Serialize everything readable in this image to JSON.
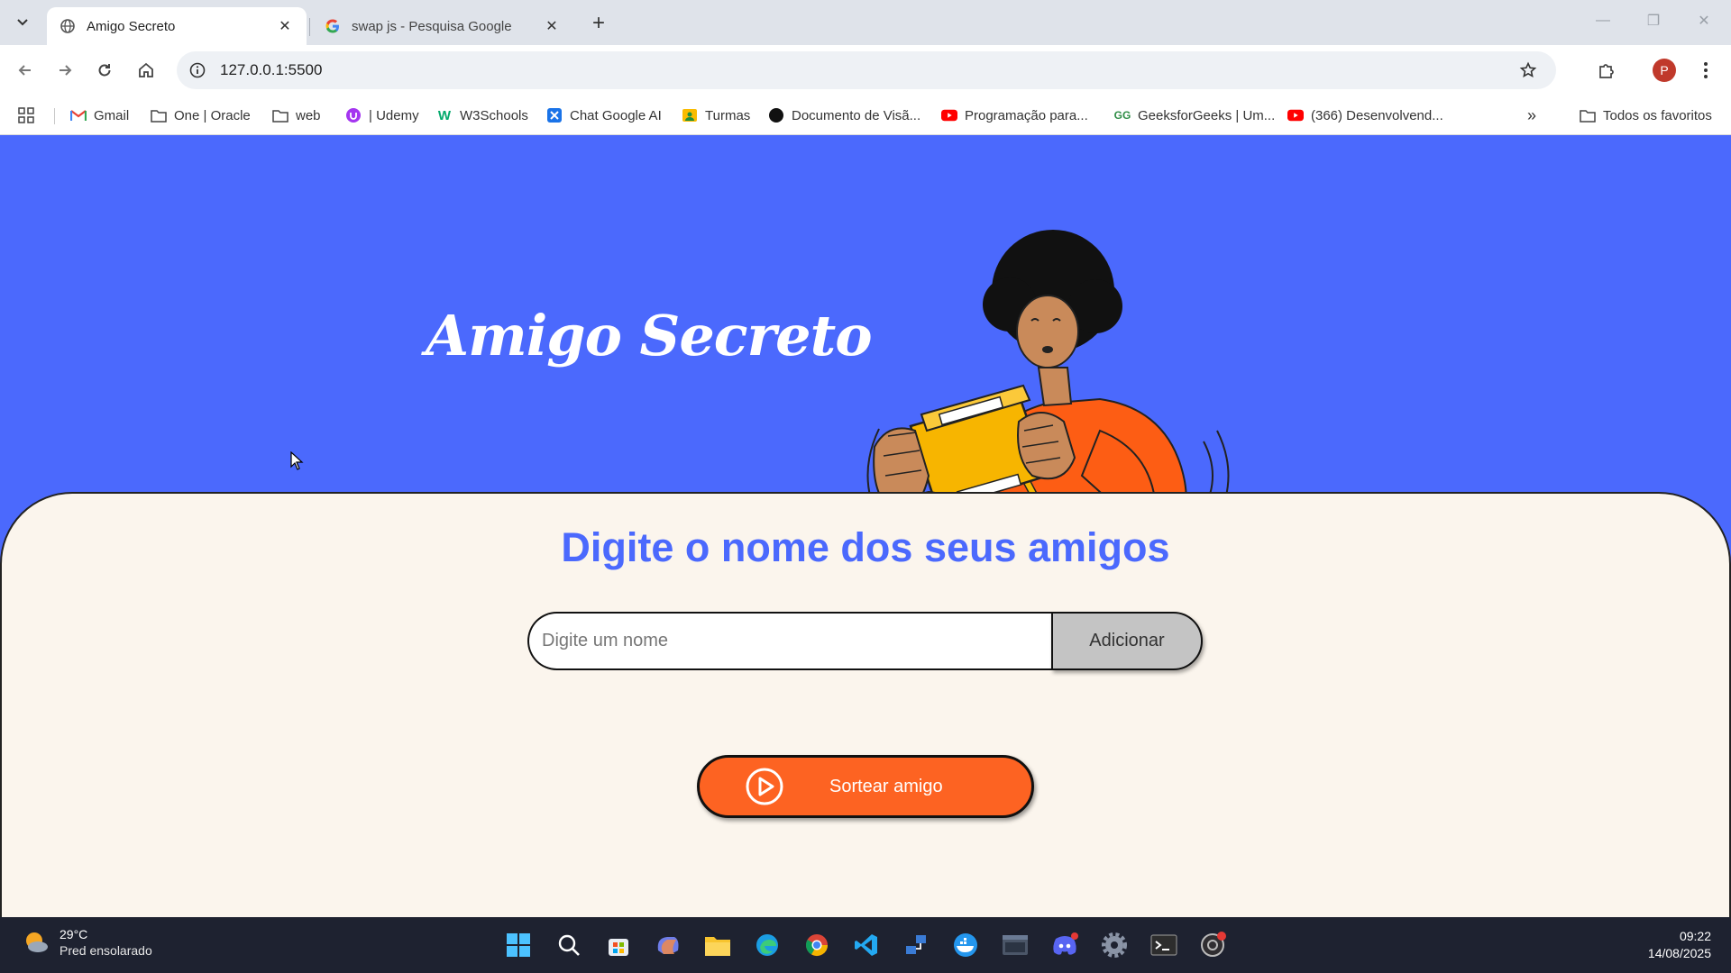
{
  "browser": {
    "tabs": [
      {
        "title": "Amigo Secreto",
        "active": true,
        "favicon": "globe-icon"
      },
      {
        "title": "swap js - Pesquisa Google",
        "active": false,
        "favicon": "google-g-icon"
      }
    ],
    "url": "127.0.0.1:5500",
    "profile_initial": "P",
    "bookmarks": [
      {
        "label": "Gmail",
        "icon": "gmail-icon"
      },
      {
        "label": "One | Oracle",
        "icon": "folder-icon"
      },
      {
        "label": "web",
        "icon": "folder-icon"
      },
      {
        "label": "| Udemy",
        "icon": "udemy-icon"
      },
      {
        "label": "W3Schools",
        "icon": "w3schools-icon"
      },
      {
        "label": "Chat Google AI",
        "icon": "chat-ai-icon"
      },
      {
        "label": "Turmas",
        "icon": "classroom-icon"
      },
      {
        "label": "Documento de Visã...",
        "icon": "doc-icon"
      },
      {
        "label": "Programação para...",
        "icon": "youtube-icon"
      },
      {
        "label": "GeeksforGeeks | Um...",
        "icon": "gfg-icon"
      },
      {
        "label": "(366) Desenvolvend...",
        "icon": "youtube-icon"
      }
    ],
    "all_bookmarks_label": "Todos os favoritos"
  },
  "page": {
    "hero_title": "Amigo Secreto",
    "section_title": "Digite o nome dos seus amigos",
    "name_input_placeholder": "Digite um nome",
    "name_input_value": "",
    "add_button_label": "Adicionar",
    "draw_button_label": "Sortear amigo",
    "colors": {
      "hero_bg": "#4b69fd",
      "card_bg": "#fbf5ed",
      "accent_orange": "#fd6322",
      "title_blue": "#4b69fd"
    }
  },
  "taskbar": {
    "weather_temp": "29°C",
    "weather_condition": "Pred ensolarado",
    "time": "09:22",
    "date": "14/08/2025"
  }
}
